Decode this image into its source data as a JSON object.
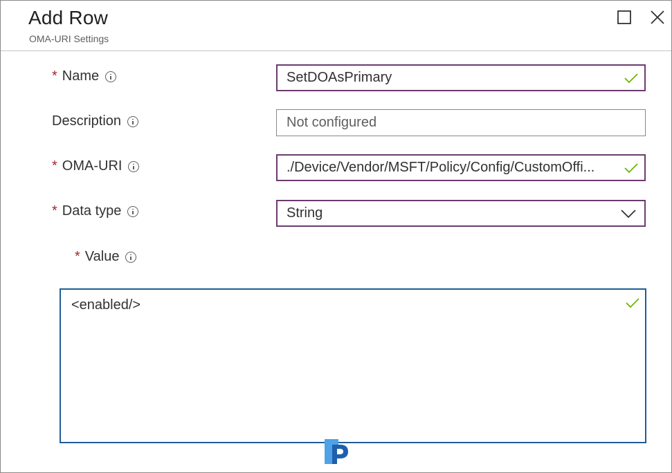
{
  "window": {
    "title": "Add Row",
    "subtitle": "OMA-URI Settings"
  },
  "fields": {
    "name": {
      "label": "Name",
      "required": true,
      "value": "SetDOAsPrimary",
      "status": "valid"
    },
    "description": {
      "label": "Description",
      "required": false,
      "value": "",
      "placeholder": "Not configured"
    },
    "oma_uri": {
      "label": "OMA-URI",
      "required": true,
      "value": "./Device/Vendor/MSFT/Policy/Config/CustomOffi...",
      "status": "valid"
    },
    "data_type": {
      "label": "Data type",
      "required": true,
      "value": "String"
    },
    "value": {
      "label": "Value",
      "required": true,
      "value": "<enabled/>",
      "status": "valid"
    }
  },
  "required_marker": "*",
  "icons": {
    "info": "info-icon",
    "check": "checkmark-icon",
    "chevron": "chevron-down-icon",
    "maximize": "maximize-icon",
    "close": "close-icon",
    "watermark": "prajwal-logo-icon"
  },
  "colors": {
    "required": "#a4262c",
    "valid_check": "#6bb700",
    "valid_border": "#6b3b6e",
    "focus_border": "#1f5c96",
    "logo_light": "#4da3e6",
    "logo_dark": "#1f5fae"
  }
}
